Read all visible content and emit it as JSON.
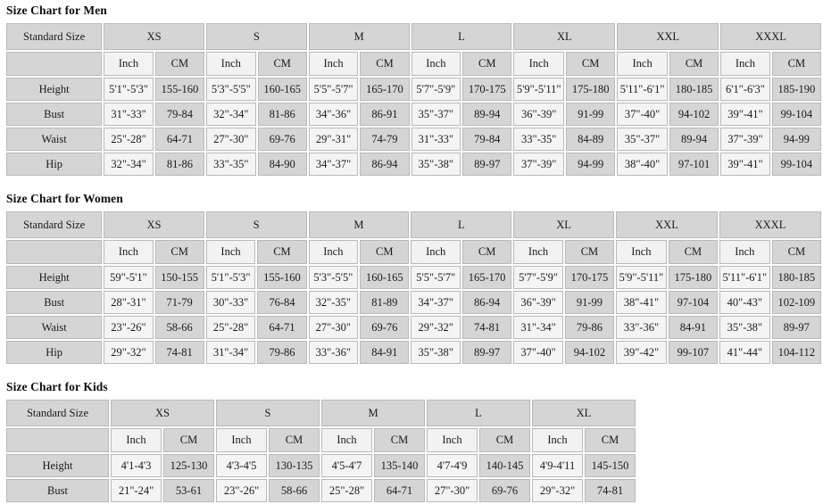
{
  "charts": [
    {
      "id": "men",
      "title": "Size Chart for Men",
      "standard_size_label": "Standard Size",
      "sizes": [
        "XS",
        "S",
        "M",
        "L",
        "XL",
        "XXL",
        "XXXL"
      ],
      "unit_labels": [
        "Inch",
        "CM"
      ],
      "rows": [
        {
          "label": "Height",
          "values": [
            [
              "5'1\"-5'3\"",
              "155-160"
            ],
            [
              "5'3\"-5'5\"",
              "160-165"
            ],
            [
              "5'5\"-5'7\"",
              "165-170"
            ],
            [
              "5'7\"-5'9\"",
              "170-175"
            ],
            [
              "5'9\"-5'11\"",
              "175-180"
            ],
            [
              "5'11\"-6'1\"",
              "180-185"
            ],
            [
              "6'1\"-6'3\"",
              "185-190"
            ]
          ]
        },
        {
          "label": "Bust",
          "values": [
            [
              "31\"-33\"",
              "79-84"
            ],
            [
              "32\"-34\"",
              "81-86"
            ],
            [
              "34\"-36\"",
              "86-91"
            ],
            [
              "35\"-37\"",
              "89-94"
            ],
            [
              "36\"-39\"",
              "91-99"
            ],
            [
              "37\"-40\"",
              "94-102"
            ],
            [
              "39\"-41\"",
              "99-104"
            ]
          ]
        },
        {
          "label": "Waist",
          "values": [
            [
              "25\"-28\"",
              "64-71"
            ],
            [
              "27\"-30\"",
              "69-76"
            ],
            [
              "29\"-31\"",
              "74-79"
            ],
            [
              "31\"-33\"",
              "79-84"
            ],
            [
              "33\"-35\"",
              "84-89"
            ],
            [
              "35\"-37\"",
              "89-94"
            ],
            [
              "37\"-39\"",
              "94-99"
            ]
          ]
        },
        {
          "label": "Hip",
          "values": [
            [
              "32\"-34\"",
              "81-86"
            ],
            [
              "33\"-35\"",
              "84-90"
            ],
            [
              "34\"-37\"",
              "86-94"
            ],
            [
              "35\"-38\"",
              "89-97"
            ],
            [
              "37\"-39\"",
              "94-99"
            ],
            [
              "38\"-40\"",
              "97-101"
            ],
            [
              "39\"-41\"",
              "99-104"
            ]
          ]
        }
      ]
    },
    {
      "id": "women",
      "title": "Size Chart for Women",
      "standard_size_label": "Standard Size",
      "sizes": [
        "XS",
        "S",
        "M",
        "L",
        "XL",
        "XXL",
        "XXXL"
      ],
      "unit_labels": [
        "Inch",
        "CM"
      ],
      "rows": [
        {
          "label": "Height",
          "values": [
            [
              "59\"-5'1\"",
              "150-155"
            ],
            [
              "5'1\"-5'3\"",
              "155-160"
            ],
            [
              "5'3\"-5'5\"",
              "160-165"
            ],
            [
              "5'5\"-5'7\"",
              "165-170"
            ],
            [
              "5'7\"-5'9\"",
              "170-175"
            ],
            [
              "5'9\"-5'11\"",
              "175-180"
            ],
            [
              "5'11\"-6'1\"",
              "180-185"
            ]
          ]
        },
        {
          "label": "Bust",
          "values": [
            [
              "28\"-31\"",
              "71-79"
            ],
            [
              "30\"-33\"",
              "76-84"
            ],
            [
              "32\"-35\"",
              "81-89"
            ],
            [
              "34\"-37\"",
              "86-94"
            ],
            [
              "36\"-39\"",
              "91-99"
            ],
            [
              "38\"-41\"",
              "97-104"
            ],
            [
              "40\"-43\"",
              "102-109"
            ]
          ]
        },
        {
          "label": "Waist",
          "values": [
            [
              "23\"-26\"",
              "58-66"
            ],
            [
              "25\"-28\"",
              "64-71"
            ],
            [
              "27\"-30\"",
              "69-76"
            ],
            [
              "29\"-32\"",
              "74-81"
            ],
            [
              "31\"-34\"",
              "79-86"
            ],
            [
              "33\"-36\"",
              "84-91"
            ],
            [
              "35\"-38\"",
              "89-97"
            ]
          ]
        },
        {
          "label": "Hip",
          "values": [
            [
              "29\"-32\"",
              "74-81"
            ],
            [
              "31\"-34\"",
              "79-86"
            ],
            [
              "33\"-36\"",
              "84-91"
            ],
            [
              "35\"-38\"",
              "89-97"
            ],
            [
              "37\"-40\"",
              "94-102"
            ],
            [
              "39\"-42\"",
              "99-107"
            ],
            [
              "41\"-44\"",
              "104-112"
            ]
          ]
        }
      ]
    },
    {
      "id": "kids",
      "title": "Size Chart for Kids",
      "standard_size_label": "Standard Size",
      "sizes": [
        "XS",
        "S",
        "M",
        "L",
        "XL"
      ],
      "unit_labels": [
        "Inch",
        "CM"
      ],
      "rows": [
        {
          "label": "Height",
          "values": [
            [
              "4'1-4'3",
              "125-130"
            ],
            [
              "4'3-4'5",
              "130-135"
            ],
            [
              "4'5-4'7",
              "135-140"
            ],
            [
              "4'7-4'9",
              "140-145"
            ],
            [
              "4'9-4'11",
              "145-150"
            ]
          ]
        },
        {
          "label": "Bust",
          "values": [
            [
              "21\"-24\"",
              "53-61"
            ],
            [
              "23\"-26\"",
              "58-66"
            ],
            [
              "25\"-28\"",
              "64-71"
            ],
            [
              "27\"-30\"",
              "69-76"
            ],
            [
              "29\"-32\"",
              "74-81"
            ]
          ]
        }
      ]
    }
  ],
  "colors": {
    "header_gray": "#d5d5d5",
    "inch_light": "#f4f4f4",
    "cm_gray": "#d5d5d5",
    "border": "#b9b9b9",
    "text": "#1a1a1a",
    "background": "#ffffff"
  }
}
